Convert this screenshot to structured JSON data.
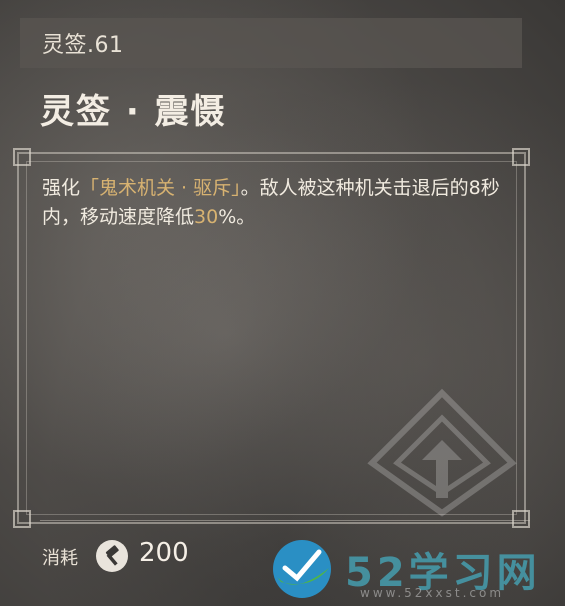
{
  "header": {
    "level_label": "灵签.61",
    "title": "灵签 · 震慑"
  },
  "description": {
    "part1": "强化",
    "highlight_name": "「鬼术机关 · 驱斥」",
    "part2": "。敌人被这种机关击退后的8秒内，移动速度降低",
    "highlight_value": "30",
    "part3": "%。"
  },
  "cost": {
    "label": "消耗",
    "icon": "hammer-icon",
    "value": "200"
  },
  "watermark": {
    "site_name": "52学习网",
    "site_url": "www.52xxst.com"
  },
  "colors": {
    "highlight": "#d7b271",
    "text": "#f0eadf",
    "watermark_accent": "#46aabe"
  }
}
